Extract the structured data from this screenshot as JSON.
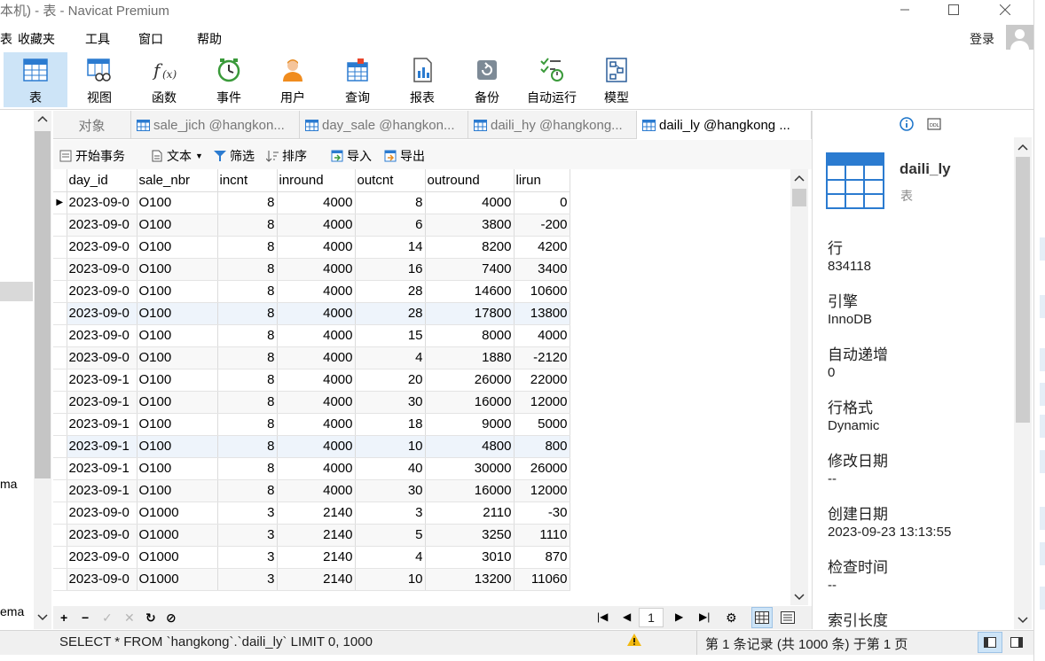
{
  "window": {
    "title": "本机) - 表 - Navicat Premium"
  },
  "menu": [
    "表",
    "收藏夹",
    "工具",
    "窗口",
    "帮助"
  ],
  "account": {
    "login_label": "登录"
  },
  "toolbar": [
    {
      "label": "表",
      "icon": "table-icon"
    },
    {
      "label": "视图",
      "icon": "view-icon"
    },
    {
      "label": "函数",
      "icon": "function-icon"
    },
    {
      "label": "事件",
      "icon": "clock-icon"
    },
    {
      "label": "用户",
      "icon": "user-icon"
    },
    {
      "label": "查询",
      "icon": "query-icon"
    },
    {
      "label": "报表",
      "icon": "report-icon"
    },
    {
      "label": "备份",
      "icon": "backup-icon"
    },
    {
      "label": "自动运行",
      "icon": "automation-icon"
    },
    {
      "label": "模型",
      "icon": "model-icon"
    }
  ],
  "leftnav": {
    "fragments": [
      "ma",
      "ema"
    ]
  },
  "tabs": [
    {
      "label": "对象"
    },
    {
      "label": "sale_jich @hangkon..."
    },
    {
      "label": "day_sale @hangkon..."
    },
    {
      "label": "daili_hy @hangkong..."
    },
    {
      "label": "daili_ly @hangkong ..."
    }
  ],
  "table_tools": {
    "begin_transaction": "开始事务",
    "text": "文本",
    "filter": "筛选",
    "sort": "排序",
    "import": "导入",
    "export": "导出"
  },
  "grid": {
    "columns": [
      "day_id",
      "sale_nbr",
      "incnt",
      "inround",
      "outcnt",
      "outround",
      "lirun"
    ],
    "rows": [
      [
        "2023-09-0",
        "O100",
        "8",
        "4000",
        "8",
        "4000",
        "0"
      ],
      [
        "2023-09-0",
        "O100",
        "8",
        "4000",
        "6",
        "3800",
        "-200"
      ],
      [
        "2023-09-0",
        "O100",
        "8",
        "4000",
        "14",
        "8200",
        "4200"
      ],
      [
        "2023-09-0",
        "O100",
        "8",
        "4000",
        "16",
        "7400",
        "3400"
      ],
      [
        "2023-09-0",
        "O100",
        "8",
        "4000",
        "28",
        "14600",
        "10600"
      ],
      [
        "2023-09-0",
        "O100",
        "8",
        "4000",
        "28",
        "17800",
        "13800"
      ],
      [
        "2023-09-0",
        "O100",
        "8",
        "4000",
        "15",
        "8000",
        "4000"
      ],
      [
        "2023-09-0",
        "O100",
        "8",
        "4000",
        "4",
        "1880",
        "-2120"
      ],
      [
        "2023-09-1",
        "O100",
        "8",
        "4000",
        "20",
        "26000",
        "22000"
      ],
      [
        "2023-09-1",
        "O100",
        "8",
        "4000",
        "30",
        "16000",
        "12000"
      ],
      [
        "2023-09-1",
        "O100",
        "8",
        "4000",
        "18",
        "9000",
        "5000"
      ],
      [
        "2023-09-1",
        "O100",
        "8",
        "4000",
        "10",
        "4800",
        "800"
      ],
      [
        "2023-09-1",
        "O100",
        "8",
        "4000",
        "40",
        "30000",
        "26000"
      ],
      [
        "2023-09-1",
        "O100",
        "8",
        "4000",
        "30",
        "16000",
        "12000"
      ],
      [
        "2023-09-0",
        "O1000",
        "3",
        "2140",
        "3",
        "2110",
        "-30"
      ],
      [
        "2023-09-0",
        "O1000",
        "3",
        "2140",
        "5",
        "3250",
        "1110"
      ],
      [
        "2023-09-0",
        "O1000",
        "3",
        "2140",
        "4",
        "3010",
        "870"
      ],
      [
        "2023-09-0",
        "O1000",
        "3",
        "2140",
        "10",
        "13200",
        "11060"
      ]
    ]
  },
  "pager": {
    "page": "1"
  },
  "status": {
    "sql": "SELECT * FROM `hangkong`.`daili_ly` LIMIT 0, 1000",
    "records": "第 1 条记录 (共 1000 条) 于第 1 页"
  },
  "info": {
    "name": "daili_ly",
    "type": "表",
    "props": [
      {
        "label": "行",
        "value": "834118"
      },
      {
        "label": "引擎",
        "value": "InnoDB"
      },
      {
        "label": "自动递增",
        "value": "0"
      },
      {
        "label": "行格式",
        "value": "Dynamic"
      },
      {
        "label": "修改日期",
        "value": "--"
      },
      {
        "label": "创建日期",
        "value": "2023-09-23 13:13:55"
      },
      {
        "label": "检查时间",
        "value": "--"
      },
      {
        "label": "索引长度",
        "value": ""
      }
    ]
  },
  "colors": {
    "accent": "#1a73c9",
    "active_tool_bg": "#cde4f7",
    "table_icon_blue": "#2b7bd0"
  }
}
